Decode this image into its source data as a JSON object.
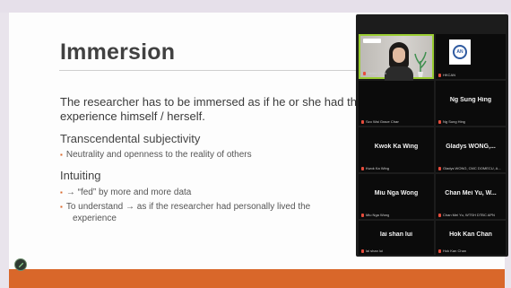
{
  "slide": {
    "title": "Immersion",
    "paragraph_line1": "The researcher has to be immersed as if he or she had th",
    "paragraph_line2": "experience himself / herself.",
    "heading1": "Transcendental subjectivity",
    "bullet1": "Neutrality and openness to the reality of others",
    "heading2": "Intuiting",
    "bullet2": "→ “fed” by more and more data",
    "bullet3_line1": "To understand → as if the researcher had personally lived the",
    "bullet3_line2": "experience",
    "accent_color": "#d9672a"
  },
  "toolbar": {
    "pen_icon": "pen-icon"
  },
  "participants": [
    {
      "name": "",
      "caption": "Helen Chan",
      "type": "video"
    },
    {
      "name": "",
      "caption": "HKCAN",
      "type": "logo",
      "logo_text": "AN"
    },
    {
      "name": "Ng Sung Hing",
      "caption": "Szo Wai Grace Chan"
    },
    {
      "name": "",
      "caption": "Ng Sung Hing"
    },
    {
      "name": "Kwok Ka Wing",
      "caption": "Kwok Ka Wing"
    },
    {
      "name": "Gladys  WONG,...",
      "caption": "Gladys WONG, CMC DOMECU, A..."
    },
    {
      "name": "Miu Nga Wong",
      "caption": "Miu Nga Wong"
    },
    {
      "name": "Chan Mei Yu, W...",
      "caption": "Chan Mei Yu, WTSH DTBC APN"
    },
    {
      "name": "lai shan lui",
      "caption": "lai shan lui"
    },
    {
      "name": "Hok Kan Chan",
      "caption": "Hok Kan Chan"
    }
  ]
}
